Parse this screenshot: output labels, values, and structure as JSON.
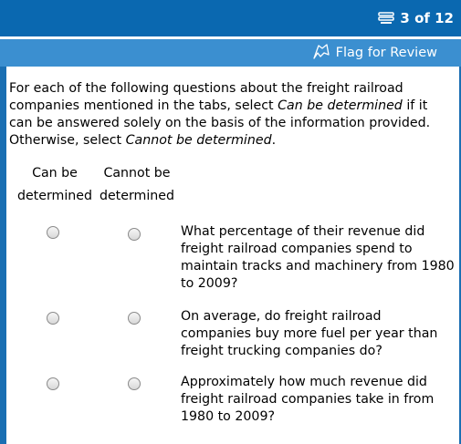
{
  "header": {
    "progress_text": "3 of 12",
    "progress_icon": "question-list-icon"
  },
  "toolbar": {
    "flag_label": "Flag for Review",
    "flag_icon": "flag-icon"
  },
  "instructions": {
    "part1": "For each of the following questions about the freight railroad companies mentioned in the tabs, select ",
    "italic1": "Can be determined",
    "part2": " if it can be answered solely on the basis of the information provided. Otherwise, select ",
    "italic2": "Cannot be determined",
    "part3": "."
  },
  "columns": {
    "can_line1": "Can be",
    "can_line2": "determined",
    "cannot_line1": "Cannot be",
    "cannot_line2": "determined"
  },
  "questions": [
    {
      "text": "What percentage of their revenue did freight railroad companies spend to maintain tracks and machinery from 1980 to 2009?",
      "selected": null
    },
    {
      "text": "On average, do freight railroad companies buy more fuel per year than freight trucking companies do?",
      "selected": null
    },
    {
      "text": "Approximately how much revenue did freight railroad companies take in from 1980 to 2009?",
      "selected": null
    }
  ],
  "colors": {
    "topbar": "#0a68b0",
    "flagbar": "#3b8fd0"
  }
}
